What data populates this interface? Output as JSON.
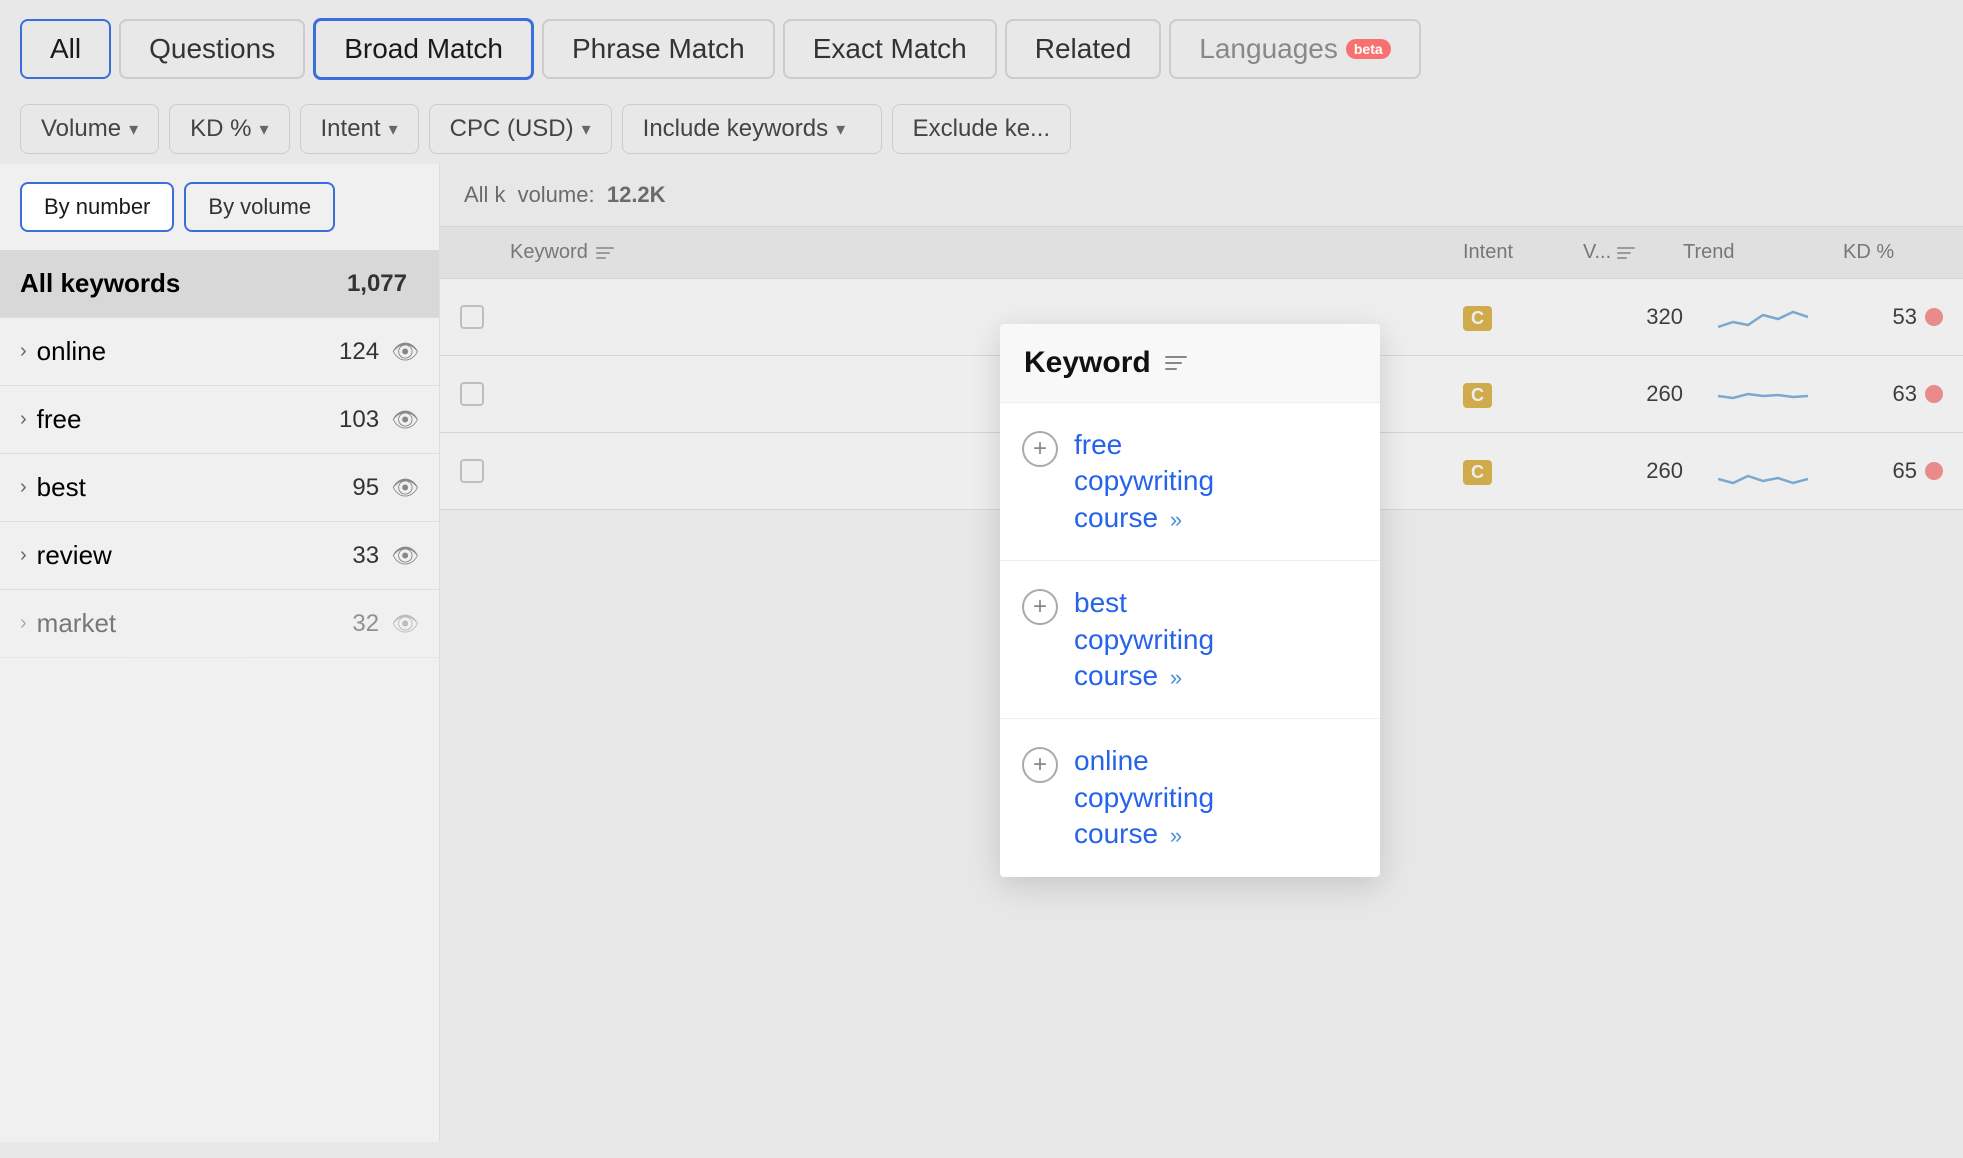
{
  "tabs": [
    {
      "id": "all",
      "label": "All",
      "active": true
    },
    {
      "id": "questions",
      "label": "Questions",
      "active": false
    },
    {
      "id": "broad-match",
      "label": "Broad Match",
      "active": false,
      "highlighted": true
    },
    {
      "id": "phrase-match",
      "label": "Phrase Match",
      "active": false
    },
    {
      "id": "exact-match",
      "label": "Exact Match",
      "active": false
    },
    {
      "id": "related",
      "label": "Related",
      "active": false
    },
    {
      "id": "languages",
      "label": "Languages",
      "active": false,
      "beta": true
    }
  ],
  "filters": [
    {
      "id": "volume",
      "label": "Volume"
    },
    {
      "id": "kd",
      "label": "KD %"
    },
    {
      "id": "intent",
      "label": "Intent"
    },
    {
      "id": "cpc",
      "label": "CPC (USD)"
    },
    {
      "id": "include-keywords",
      "label": "Include keywords"
    },
    {
      "id": "exclude-keywords",
      "label": "Exclude ke..."
    }
  ],
  "sidebar": {
    "view_by_number_label": "By number",
    "view_by_volume_label": "By volume",
    "items": [
      {
        "id": "all",
        "label": "All keywords",
        "count": "1,077",
        "selected": true,
        "hasChevron": false
      },
      {
        "id": "online",
        "label": "online",
        "count": "124",
        "selected": false,
        "hasChevron": true
      },
      {
        "id": "free",
        "label": "free",
        "count": "103",
        "selected": false,
        "hasChevron": true
      },
      {
        "id": "best",
        "label": "best",
        "count": "95",
        "selected": false,
        "hasChevron": true
      },
      {
        "id": "review",
        "label": "review",
        "count": "33",
        "selected": false,
        "hasChevron": true
      },
      {
        "id": "market",
        "label": "market",
        "count": "32",
        "selected": false,
        "hasChevron": true
      }
    ]
  },
  "content": {
    "header_text": "All k",
    "volume_label": "volume:",
    "volume_value": "12.2K",
    "columns": [
      "Keyword",
      "Intent",
      "V...",
      "Trend",
      "KD %"
    ],
    "rows": [
      {
        "keyword": "",
        "intent": "C",
        "volume": "320",
        "kd": "53",
        "trend_type": "wavy"
      },
      {
        "keyword": "",
        "intent": "C",
        "volume": "260",
        "kd": "63",
        "trend_type": "flat"
      },
      {
        "keyword": "",
        "intent": "C",
        "volume": "260",
        "kd": "65",
        "trend_type": "low-wavy"
      }
    ]
  },
  "popup": {
    "title": "Keyword",
    "items": [
      {
        "keyword_line1": "free",
        "keyword_line2": "copywriting",
        "keyword_line3": "course"
      },
      {
        "keyword_line1": "best",
        "keyword_line2": "copywriting",
        "keyword_line3": "course"
      },
      {
        "keyword_line1": "online",
        "keyword_line2": "copywriting",
        "keyword_line3": "course"
      }
    ]
  },
  "icons": {
    "chevron_down": "▾",
    "chevron_right": "›",
    "eye": "👁",
    "plus": "+",
    "double_chevron": "»",
    "beta": "beta"
  }
}
